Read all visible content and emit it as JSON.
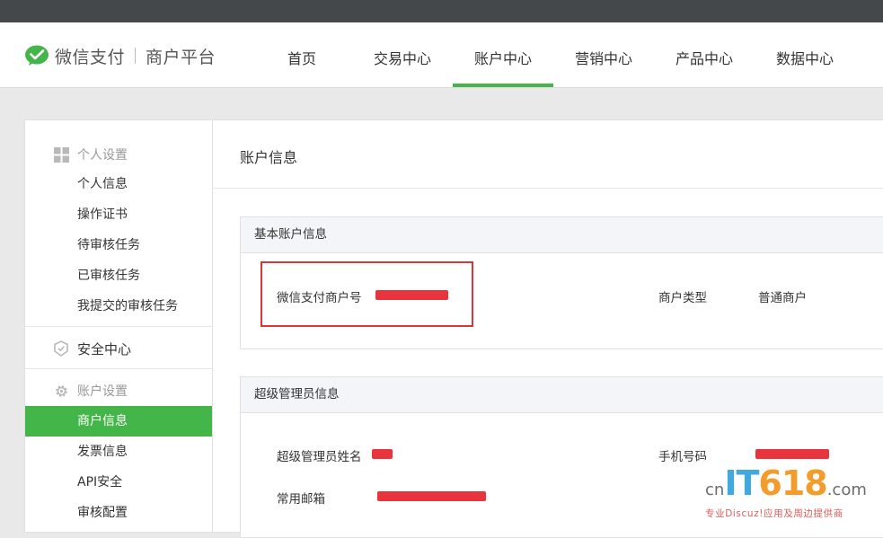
{
  "header": {
    "brand": "微信支付",
    "platform": "商户平台",
    "nav": [
      {
        "label": "首页"
      },
      {
        "label": "交易中心"
      },
      {
        "label": "账户中心"
      },
      {
        "label": "营销中心"
      },
      {
        "label": "产品中心"
      },
      {
        "label": "数据中心"
      }
    ],
    "active_nav": "账户中心"
  },
  "sidebar": {
    "personal": {
      "title": "个人设置",
      "icon": "grid-icon",
      "items": [
        "个人信息",
        "操作证书",
        "待审核任务",
        "已审核任务",
        "我提交的审核任务"
      ]
    },
    "security": {
      "title": "安全中心",
      "icon": "shield-icon"
    },
    "account": {
      "title": "账户设置",
      "icon": "gear-icon",
      "items": [
        "商户信息",
        "发票信息",
        "API安全",
        "审核配置"
      ],
      "active": "商户信息"
    }
  },
  "main": {
    "title": "账户信息",
    "basic": {
      "header": "基本账户信息",
      "merchant_id_label": "微信支付商户号",
      "merchant_type_label": "商户类型",
      "merchant_type_value": "普通商户"
    },
    "admin": {
      "header": "超级管理员信息",
      "name_label": "超级管理员姓名",
      "phone_label": "手机号码",
      "email_label": "常用邮箱"
    }
  },
  "watermark": {
    "prefix": "cn",
    "brand_letters": "IT",
    "brand_number": "618",
    "suffix": ".com",
    "tagline": "专业Discuz!应用及周边提供商"
  },
  "colors": {
    "accent": "#44b549",
    "topbar": "#45484b",
    "redaction": "#e8343c",
    "highlight_box": "#d9353b"
  }
}
